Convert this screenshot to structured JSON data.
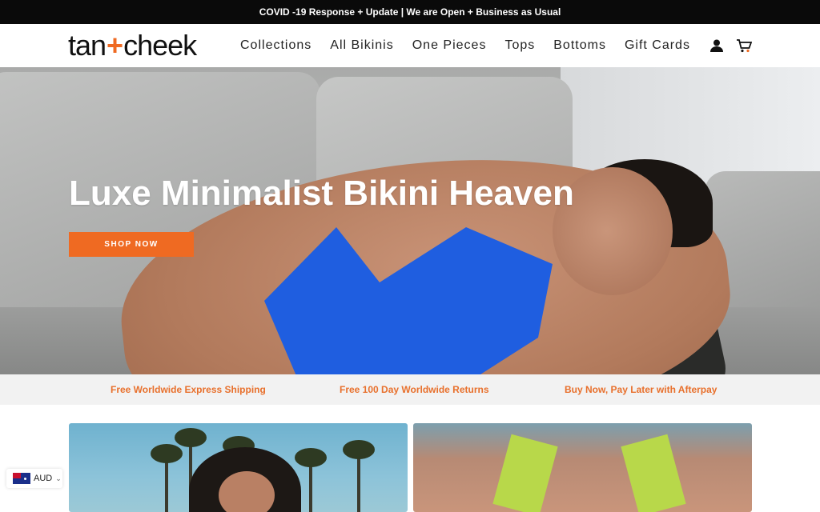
{
  "announcement": "COVID -19 Response + Update | We are Open + Business as Usual",
  "brand": {
    "word1": "tan",
    "plus": "+",
    "word2": "cheek",
    "accent_color": "#ef6a22"
  },
  "nav": {
    "items": [
      {
        "label": "Collections"
      },
      {
        "label": "All Bikinis"
      },
      {
        "label": "One Pieces"
      },
      {
        "label": "Tops"
      },
      {
        "label": "Bottoms"
      },
      {
        "label": "Gift Cards"
      }
    ]
  },
  "header_icons": {
    "account": "user-icon",
    "cart": "cart-icon"
  },
  "hero": {
    "title": "Luxe Minimalist Bikini Heaven",
    "button_label": "SHOP NOW"
  },
  "usps": [
    {
      "label": "Free Worldwide Express Shipping"
    },
    {
      "label": "Free 100 Day Worldwide Returns"
    },
    {
      "label": "Buy Now, Pay Later with Afterpay"
    }
  ],
  "currency": {
    "code": "AUD",
    "flag": "australia-flag-icon"
  }
}
